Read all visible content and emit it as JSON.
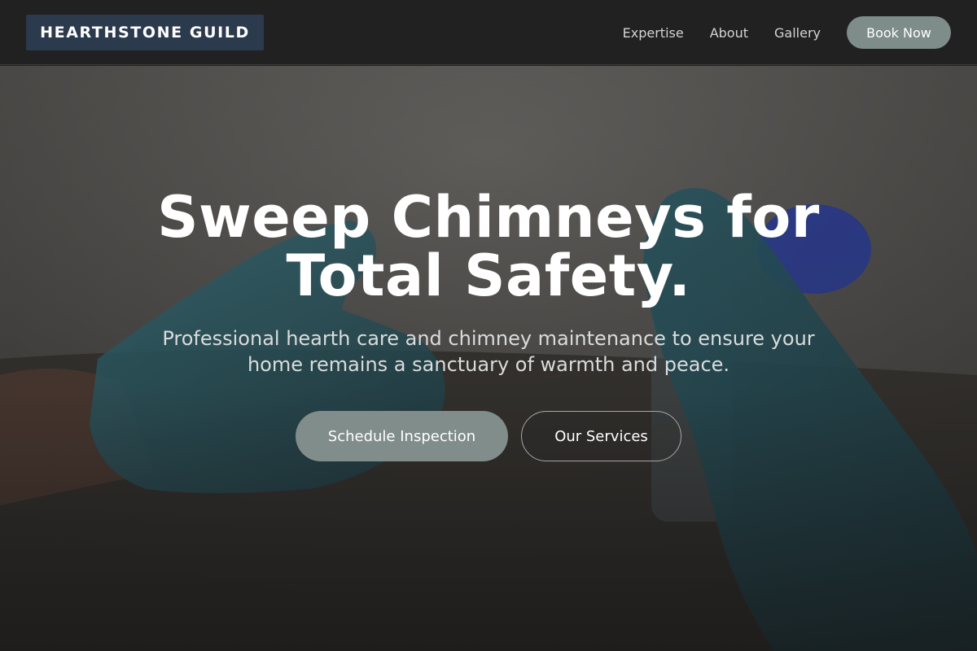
{
  "nav": {
    "brand": "HEARTHSTONE GUILD",
    "links": [
      "Expertise",
      "About",
      "Gallery"
    ],
    "cta": "Book Now"
  },
  "hero": {
    "title_line1": "Sweep Chimneys for",
    "title_line2": "Total Safety.",
    "subtitle_line1": "Professional hearth care and chimney maintenance to ensure your",
    "subtitle_line2": "home remains a sanctuary of warmth and peace.",
    "primary_button": "Schedule Inspection",
    "secondary_button": "Our Services"
  },
  "colors": {
    "navbar_bg": "#222121",
    "brand_bg": "#2b3a4d",
    "accent": "#7e8c8a",
    "glove": "#2f6e7a"
  }
}
